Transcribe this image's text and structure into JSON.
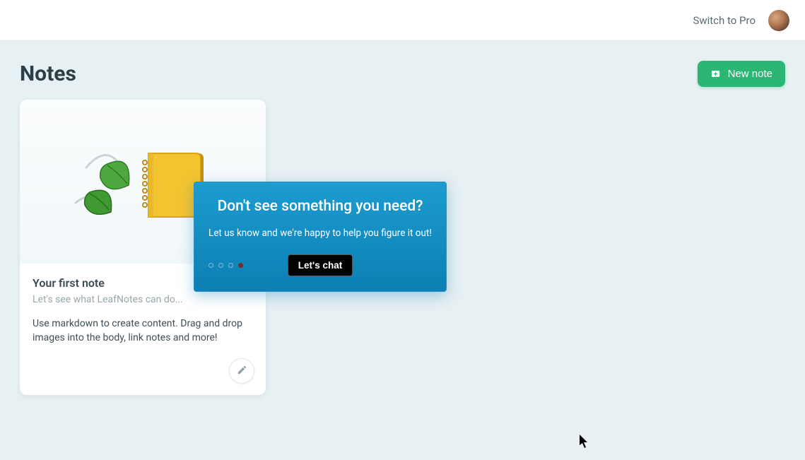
{
  "header": {
    "switch_label": "Switch to Pro"
  },
  "page": {
    "title": "Notes",
    "new_note_label": "New note"
  },
  "note": {
    "title": "Your first note",
    "subtitle": "Let's see what LeafNotes can do...",
    "body": "Use markdown to create content. Drag and drop images into the body, link notes and more!",
    "image_icon": "leaf-notebook"
  },
  "popup": {
    "title": "Don't see something you need?",
    "subtitle": "Let us know and we're happy to help you figure it out!",
    "button_label": "Let's chat",
    "step_count": 4,
    "active_step": 4
  },
  "colors": {
    "accent_green": "#2bb673",
    "popup_blue": "#1490c6"
  }
}
